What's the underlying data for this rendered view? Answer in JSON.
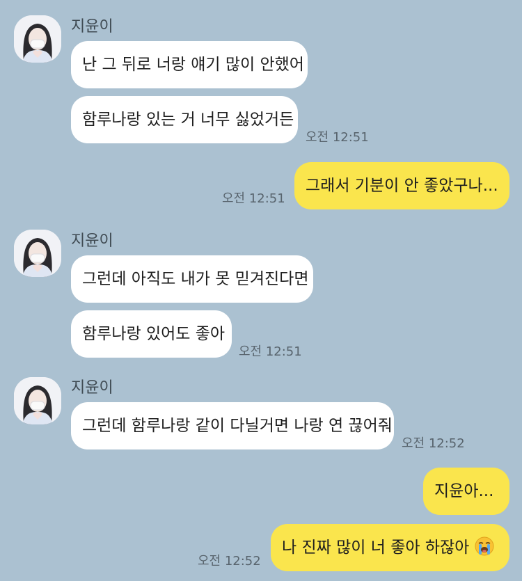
{
  "sender_name": "지윤이",
  "messages": [
    {
      "text": "난 그 뒤로 너랑 얘기 많이 안했어"
    },
    {
      "text": "함루나랑 있는 거 너무 싫었거든",
      "time": "오전 12:51"
    },
    {
      "text": "그래서 기분이 안 좋았구나...",
      "time": "오전 12:51"
    },
    {
      "text": "그런데 아직도 내가 못 믿겨진다면"
    },
    {
      "text": "함루나랑 있어도 좋아",
      "time": "오전 12:51"
    },
    {
      "text": "그런데 함루나랑 같이 다닐거면 나랑 연 끊어줘",
      "time": "오전 12:52"
    },
    {
      "text": "지윤아..."
    },
    {
      "text": "나 진짜 많이 너 좋아 하잖아",
      "time": "오전 12:52",
      "emoji": "loudly-crying-face-emoji"
    }
  ],
  "colors": {
    "background": "#abc1d1",
    "incoming_bubble": "#ffffff",
    "outgoing_bubble": "#fae54d"
  }
}
